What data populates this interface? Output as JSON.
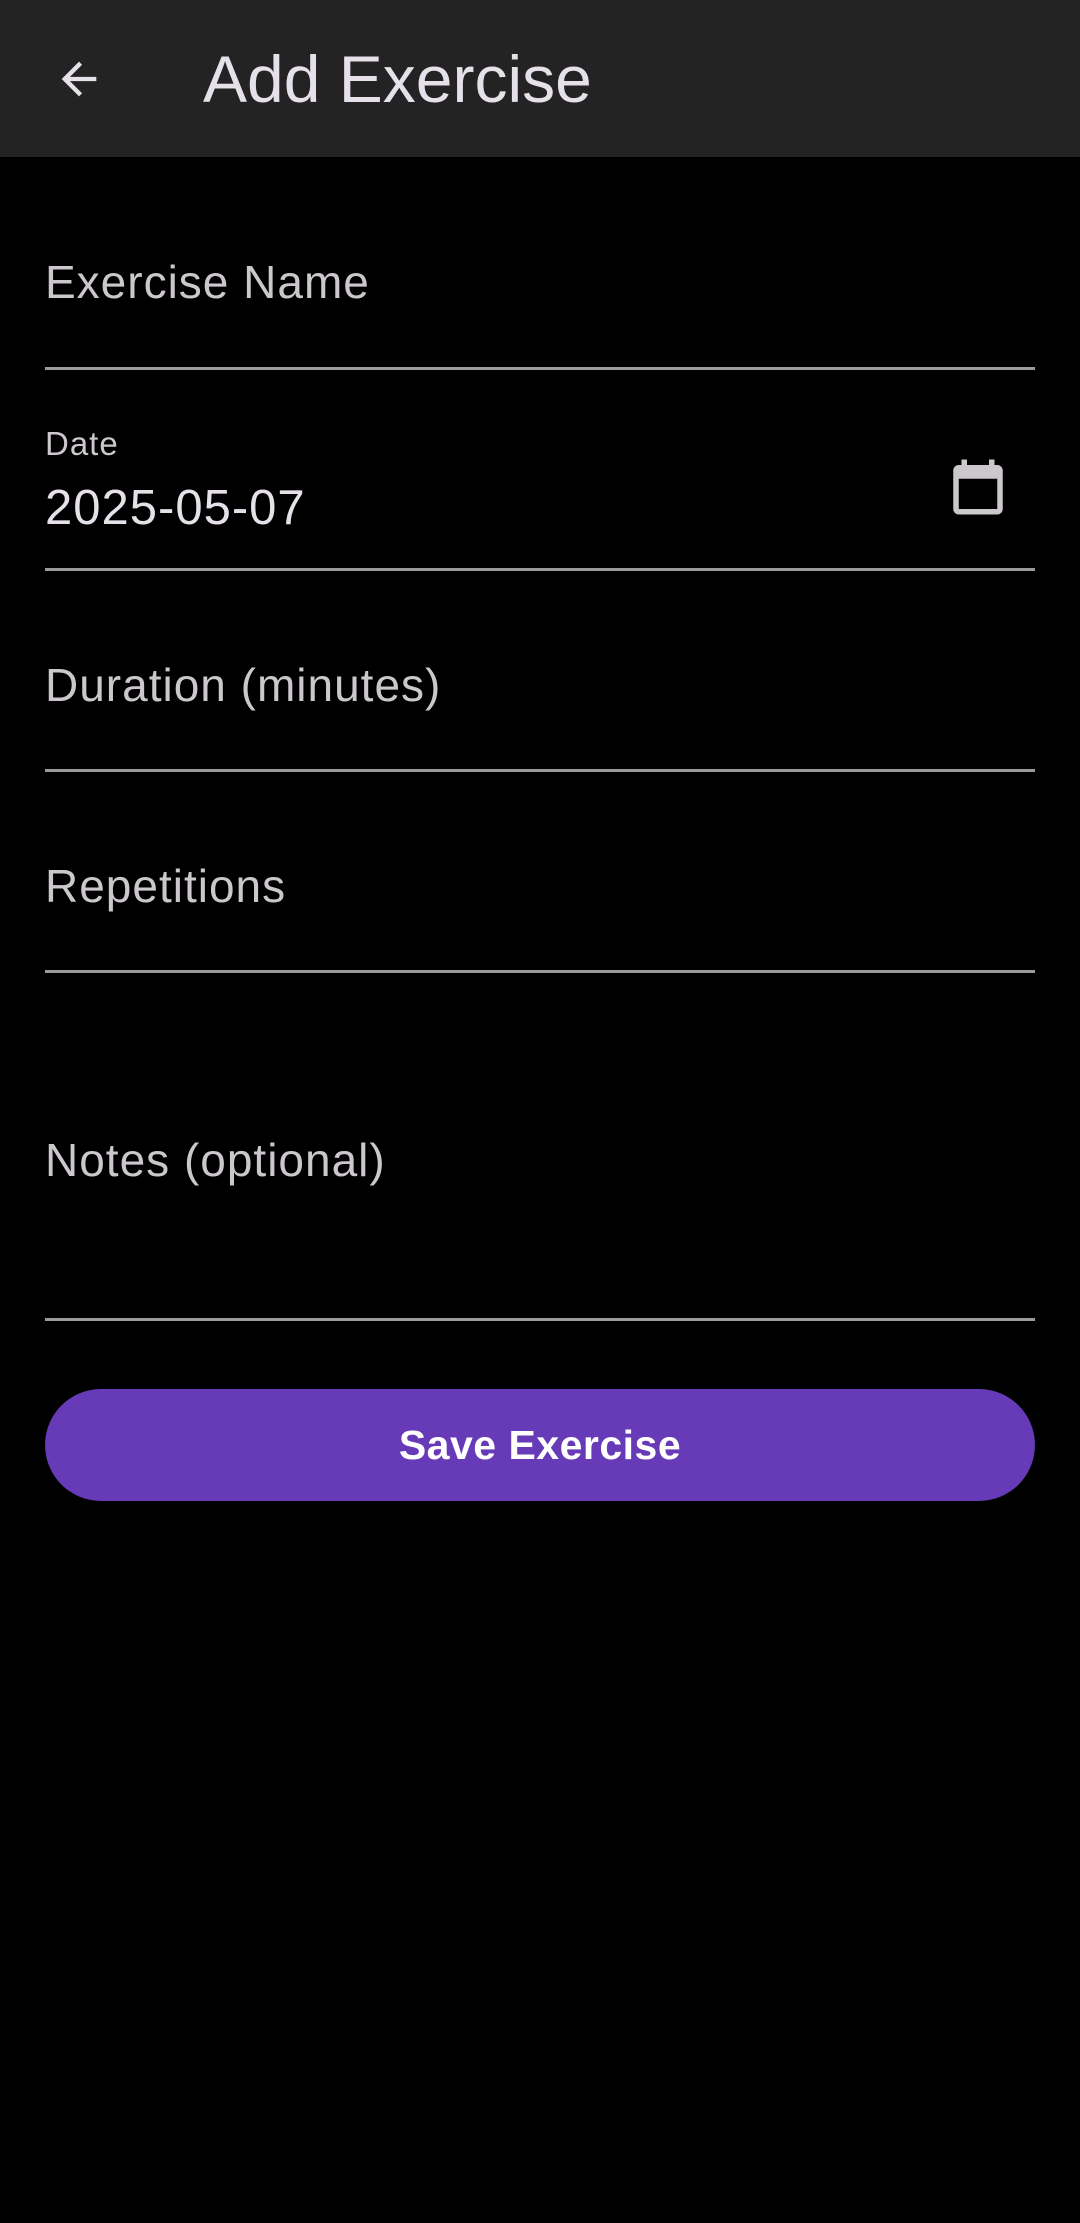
{
  "app_bar": {
    "title": "Add Exercise",
    "back_icon": "arrow-back-icon",
    "background": "#232323"
  },
  "form": {
    "exercise_name": {
      "label": "Exercise Name",
      "value": ""
    },
    "date": {
      "label": "Date",
      "value": "2025-05-07",
      "icon": "calendar-icon"
    },
    "duration": {
      "label": "Duration (minutes)",
      "value": ""
    },
    "repetitions": {
      "label": "Repetitions",
      "value": ""
    },
    "notes": {
      "label": "Notes (optional)",
      "value": ""
    }
  },
  "save_button": {
    "label": "Save Exercise",
    "color": "#673ab7"
  },
  "colors": {
    "background": "#000000",
    "text_primary": "#e6e1e8",
    "text_secondary": "#cbc7cc",
    "underline": "#9d9a9f"
  }
}
